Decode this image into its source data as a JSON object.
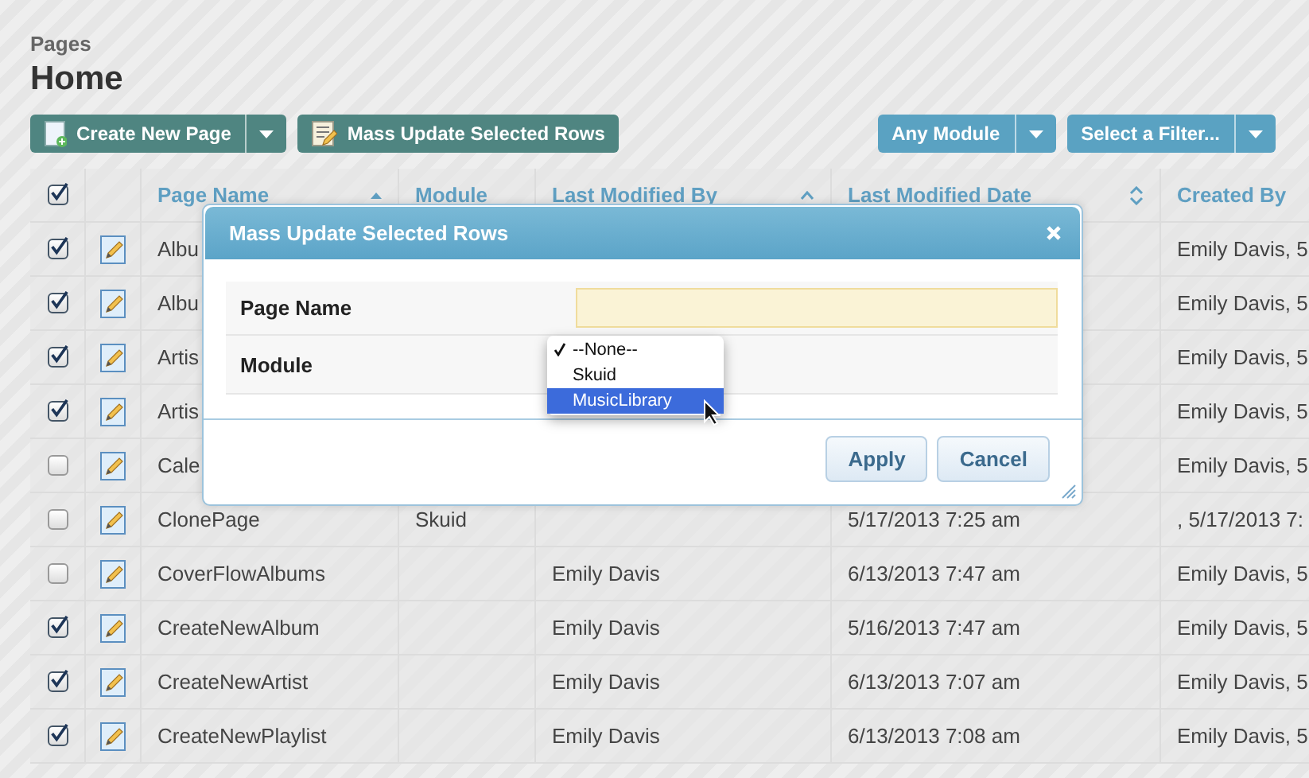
{
  "breadcrumb": "Pages",
  "title": "Home",
  "toolbar": {
    "left": [
      {
        "label": "Create New Page",
        "kind": "split"
      },
      {
        "label": "Mass Update Selected Rows",
        "kind": "plain"
      }
    ],
    "right": [
      {
        "label": "Any Module",
        "kind": "split"
      },
      {
        "label": "Select a Filter...",
        "kind": "split"
      }
    ]
  },
  "table": {
    "select_all": true,
    "columns": [
      {
        "label": "Page Name"
      },
      {
        "label": "Module"
      },
      {
        "label": "Last Modified By"
      },
      {
        "label": "Last Modified Date"
      },
      {
        "label": "Created By"
      }
    ],
    "rows": [
      {
        "selected": true,
        "page_name": "Albu",
        "created_by": "Emily Davis, 5"
      },
      {
        "selected": true,
        "page_name": "Albu",
        "created_by": "Emily Davis, 5"
      },
      {
        "selected": true,
        "page_name": "Artis",
        "created_by": "Emily Davis, 5"
      },
      {
        "selected": true,
        "page_name": "Artis",
        "created_by": "Emily Davis, 5"
      },
      {
        "selected": false,
        "page_name": "Cale",
        "created_by": "Emily Davis, 5"
      },
      {
        "selected": false,
        "page_name": "ClonePage",
        "module": "Skuid",
        "last_modified_date": "5/17/2013 7:25 am",
        "created_by": ", 5/17/2013 7:"
      },
      {
        "selected": false,
        "page_name": "CoverFlowAlbums",
        "last_modified_by": "Emily Davis",
        "last_modified_date": "6/13/2013 7:47 am",
        "created_by": "Emily Davis, 5"
      },
      {
        "selected": true,
        "page_name": "CreateNewAlbum",
        "last_modified_by": "Emily Davis",
        "last_modified_date": "5/16/2013 7:47 am",
        "created_by": "Emily Davis, 5"
      },
      {
        "selected": true,
        "page_name": "CreateNewArtist",
        "last_modified_by": "Emily Davis",
        "last_modified_date": "6/13/2013 7:07 am",
        "created_by": "Emily Davis, 5"
      },
      {
        "selected": true,
        "page_name": "CreateNewPlaylist",
        "last_modified_by": "Emily Davis",
        "last_modified_date": "6/13/2013 7:08 am",
        "created_by": "Emily Davis, 5"
      }
    ]
  },
  "dialog": {
    "title": "Mass Update Selected Rows",
    "fields": [
      {
        "label": "Page Name",
        "kind": "text"
      },
      {
        "label": "Module",
        "kind": "select"
      }
    ],
    "dropdown": [
      {
        "label": "--None--",
        "checked": true,
        "highlighted": false
      },
      {
        "label": "Skuid",
        "checked": false,
        "highlighted": false
      },
      {
        "label": "MusicLibrary",
        "checked": false,
        "highlighted": true
      }
    ],
    "buttons": [
      "Apply",
      "Cancel"
    ]
  }
}
